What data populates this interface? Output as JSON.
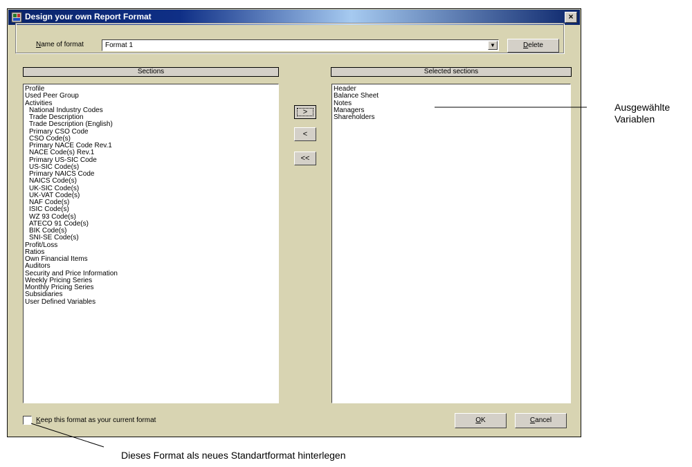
{
  "window": {
    "title": "Design your own Report Format",
    "close_glyph": "×"
  },
  "name_of_format": {
    "label_accel": "N",
    "label_rest": "ame of format",
    "value": "Format 1",
    "delete_accel": "D",
    "delete_rest": "elete"
  },
  "sections": {
    "header": "Sections",
    "items": [
      {
        "label": "Profile",
        "indent": false
      },
      {
        "label": "Used Peer Group",
        "indent": false
      },
      {
        "label": "Activities",
        "indent": false
      },
      {
        "label": "National Industry Codes",
        "indent": true
      },
      {
        "label": "Trade Description",
        "indent": true
      },
      {
        "label": "Trade Description (English)",
        "indent": true
      },
      {
        "label": "Primary CSO Code",
        "indent": true
      },
      {
        "label": "CSO Code(s)",
        "indent": true
      },
      {
        "label": "Primary NACE Code Rev.1",
        "indent": true
      },
      {
        "label": "NACE Code(s) Rev.1",
        "indent": true
      },
      {
        "label": "Primary US-SIC Code",
        "indent": true
      },
      {
        "label": "US-SIC Code(s)",
        "indent": true
      },
      {
        "label": "Primary NAICS Code",
        "indent": true
      },
      {
        "label": "NAICS Code(s)",
        "indent": true
      },
      {
        "label": "UK-SIC Code(s)",
        "indent": true
      },
      {
        "label": "UK-VAT Code(s)",
        "indent": true
      },
      {
        "label": "NAF Code(s)",
        "indent": true
      },
      {
        "label": "ISIC Code(s)",
        "indent": true
      },
      {
        "label": "WZ 93 Code(s)",
        "indent": true
      },
      {
        "label": "ATECO 91 Code(s)",
        "indent": true
      },
      {
        "label": "BIK Code(s)",
        "indent": true
      },
      {
        "label": "SNI-SE Code(s)",
        "indent": true
      },
      {
        "label": "Profit/Loss",
        "indent": false
      },
      {
        "label": "Ratios",
        "indent": false
      },
      {
        "label": "Own Financial Items",
        "indent": false
      },
      {
        "label": "Auditors",
        "indent": false
      },
      {
        "label": "Security and Price Information",
        "indent": false
      },
      {
        "label": "Weekly Pricing Series",
        "indent": false
      },
      {
        "label": "Monthly Pricing Series",
        "indent": false
      },
      {
        "label": "Subsidiaries",
        "indent": false
      },
      {
        "label": "User Defined Variables",
        "indent": false
      }
    ]
  },
  "selected_sections": {
    "header": "Selected sections",
    "items": [
      "Header",
      "Balance Sheet",
      "Notes",
      "Managers",
      "Shareholders"
    ]
  },
  "move_buttons": {
    "add": ">",
    "remove": "<",
    "remove_all": "<<"
  },
  "footer": {
    "keep_accel": "K",
    "keep_rest": "eep this format as your current format",
    "keep_checked": false,
    "ok_accel": "O",
    "ok_rest": "K",
    "cancel_accel": "C",
    "cancel_rest": "ancel"
  },
  "annotations": {
    "right_line1": "Ausgewählte",
    "right_line2": "Variablen",
    "bottom": "Dieses Format als neues Standartformat hinterlegen"
  }
}
